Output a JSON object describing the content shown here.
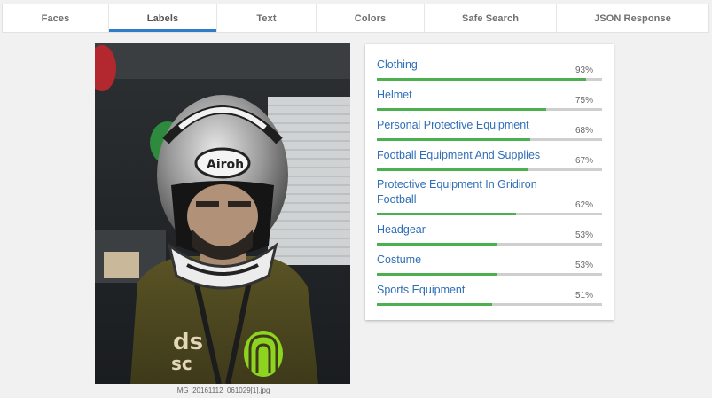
{
  "tabs": [
    {
      "label": "Faces",
      "active": false
    },
    {
      "label": "Labels",
      "active": true
    },
    {
      "label": "Text",
      "active": false
    },
    {
      "label": "Colors",
      "active": false
    },
    {
      "label": "Safe Search",
      "active": false
    },
    {
      "label": "JSON Response",
      "active": false
    }
  ],
  "image": {
    "filename": "IMG_20161112_061029[1].jpg"
  },
  "labels": [
    {
      "name": "Clothing",
      "score_text": "93%",
      "score": 0.93
    },
    {
      "name": "Helmet",
      "score_text": "75%",
      "score": 0.75
    },
    {
      "name": "Personal Protective Equipment",
      "score_text": "68%",
      "score": 0.68
    },
    {
      "name": "Football Equipment And Supplies",
      "score_text": "67%",
      "score": 0.67
    },
    {
      "name": "Protective Equipment In Gridiron Football",
      "score_text": "62%",
      "score": 0.62
    },
    {
      "name": "Headgear",
      "score_text": "53%",
      "score": 0.53
    },
    {
      "name": "Costume",
      "score_text": "53%",
      "score": 0.53
    },
    {
      "name": "Sports Equipment",
      "score_text": "51%",
      "score": 0.51
    }
  ],
  "colors": {
    "accent_blue": "#2f7cc8",
    "label_link": "#2f6eb6",
    "bar_green": "#4caf50",
    "bar_track": "#cfcfcf"
  }
}
